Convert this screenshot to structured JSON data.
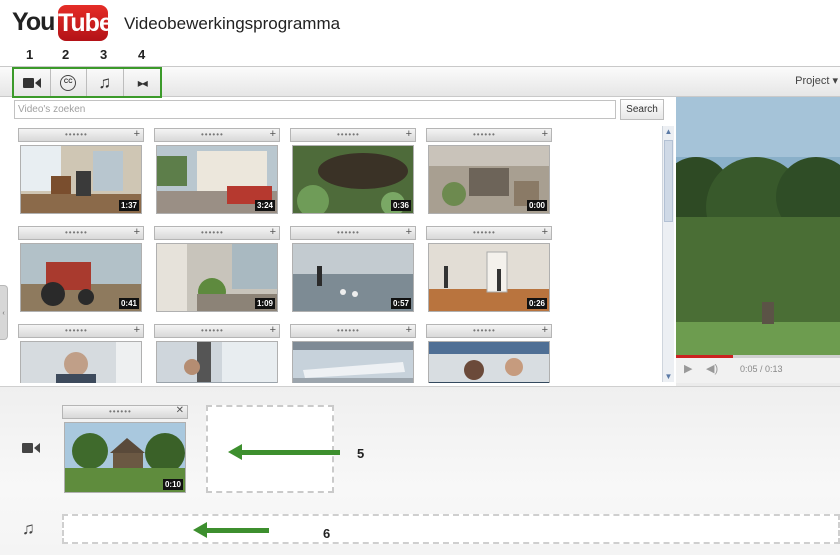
{
  "header": {
    "logo_you": "You",
    "logo_tube": "Tube",
    "title": "Videobewerkingsprogramma"
  },
  "toolbar": {
    "numbers": [
      "1",
      "2",
      "3",
      "4"
    ],
    "buttons": [
      {
        "icon": "video-camera-icon"
      },
      {
        "icon": "cc-icon",
        "glyph": "CC"
      },
      {
        "icon": "music-note-icon",
        "glyph": "♫"
      },
      {
        "icon": "transition-icon",
        "glyph": "▸◂"
      }
    ],
    "project_label": "Project ▾"
  },
  "search": {
    "placeholder": "Video's zoeken",
    "button_label": "Search"
  },
  "clips": {
    "handle_dots": "••••••",
    "add_glyph": "+",
    "items": [
      {
        "duration": "1:37",
        "scene": "room"
      },
      {
        "duration": "3:24",
        "scene": "truck"
      },
      {
        "duration": "0:36",
        "scene": "pond"
      },
      {
        "duration": "0:00",
        "scene": "yard"
      },
      {
        "duration": "0:41",
        "scene": "tractor"
      },
      {
        "duration": "1:09",
        "scene": "garden"
      },
      {
        "duration": "0:57",
        "scene": "lake"
      },
      {
        "duration": "0:26",
        "scene": "stage"
      },
      {
        "duration": "",
        "scene": "portrait"
      },
      {
        "duration": "",
        "scene": "signs"
      },
      {
        "duration": "",
        "scene": "plane"
      },
      {
        "duration": "",
        "scene": "people"
      }
    ]
  },
  "preview": {
    "time": "0:05 / 0:13",
    "progress": 0.35
  },
  "timeline": {
    "clip_duration": "0:10",
    "close_glyph": "✕",
    "labels": [
      "5",
      "6"
    ]
  },
  "colors": {
    "accent_green": "#3b9a2a",
    "youtube_red": "#e52d27"
  }
}
